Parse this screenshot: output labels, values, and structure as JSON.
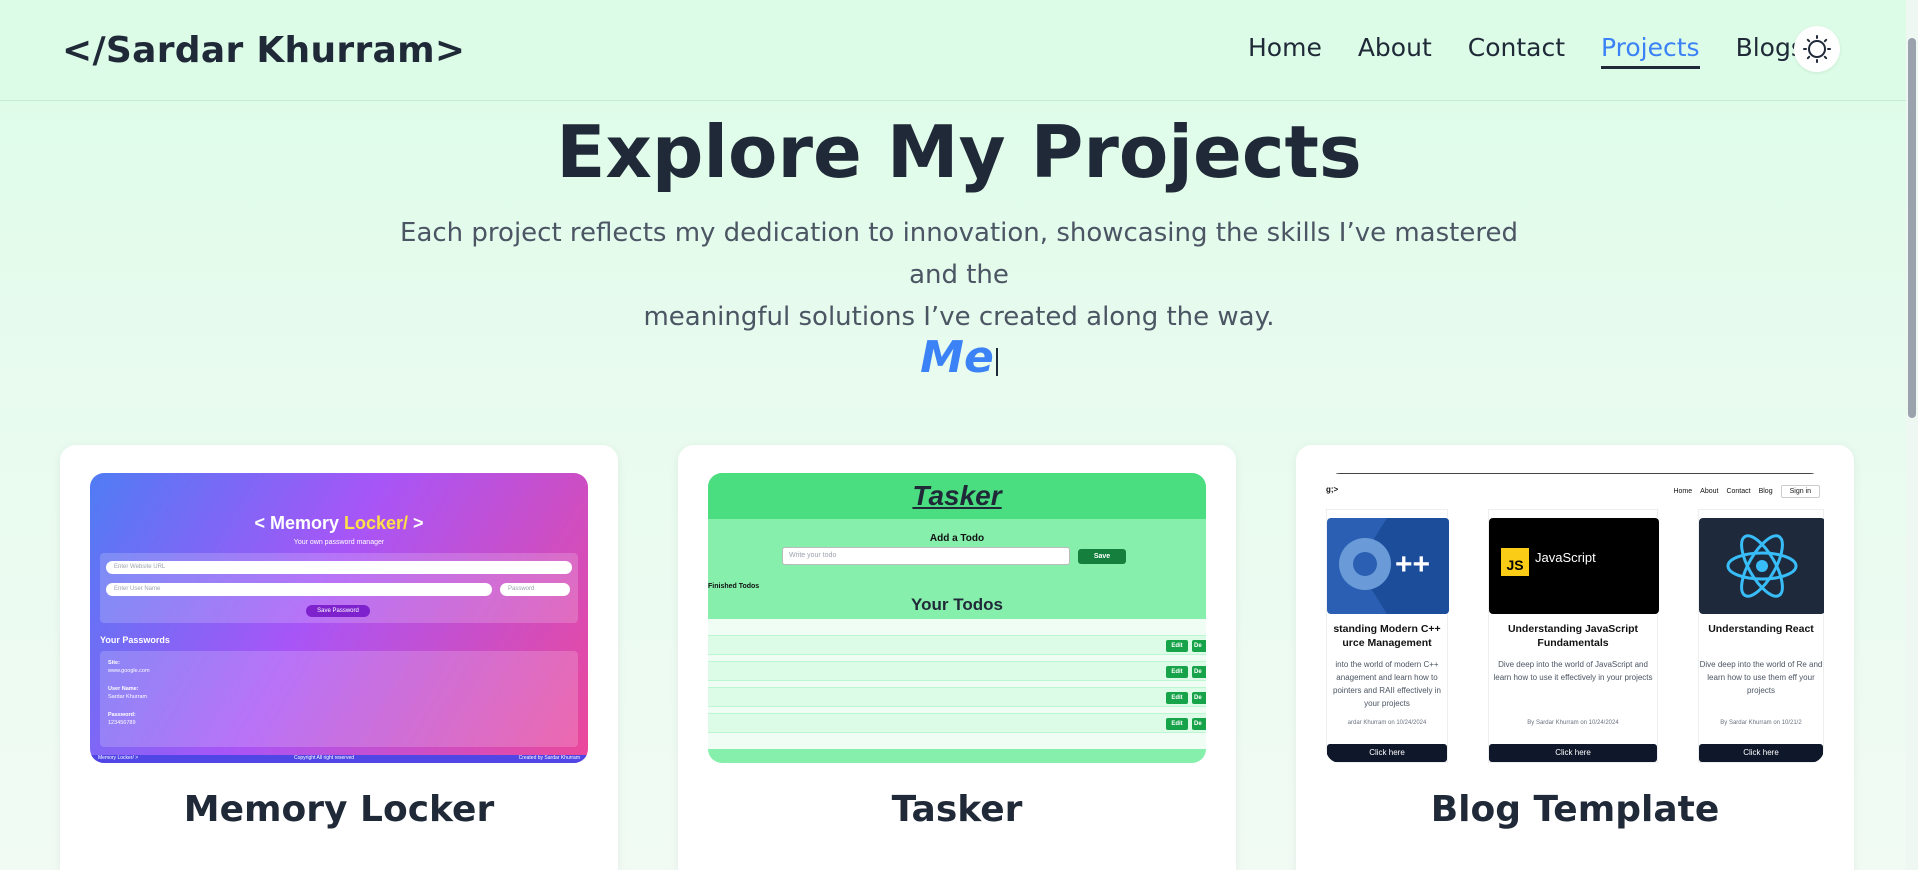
{
  "nav": {
    "logo": "</Sardar Khurram>",
    "links": [
      "Home",
      "About",
      "Contact",
      "Projects",
      "Blogs"
    ],
    "active": "Projects",
    "theme_icon": "sun-icon"
  },
  "hero": {
    "title": "Explore My Projects",
    "subtitle_line1": "Each project reflects my dedication to innovation, showcasing the skills I’ve mastered and the",
    "subtitle_line2": "meaningful solutions I’ve created along the way.",
    "typing_text": "Me"
  },
  "projects": [
    {
      "title": "Memory Locker",
      "preview": {
        "brand_left": "< Memory ",
        "brand_accent": "Locker/",
        "brand_right": " >",
        "tagline": "Your own password manager",
        "url_placeholder": "Enter Website URL",
        "user_placeholder": "Enter User Name",
        "pass_placeholder": "Password",
        "save_label": "Save Password",
        "list_heading": "Your Passwords",
        "site_label": "Site:",
        "site_value": "www.google.com",
        "user_label": "User Name:",
        "user_value": "Sardar Khurram",
        "pass_label": "Password:",
        "pass_value": "123456789",
        "footer_left": "Memory Locker/ >",
        "footer_mid": "Copyright All right reserved",
        "footer_right": "Created by Sardar Khurram"
      }
    },
    {
      "title": "Tasker",
      "preview": {
        "brand": "Tasker",
        "add_heading": "Add a Todo",
        "input_placeholder": "Write your todo",
        "save_label": "Save",
        "finished_label": "Finished Todos",
        "list_heading": "Your Todos",
        "edit_label": "Edit",
        "delete_label": "De"
      }
    },
    {
      "title": "Blog Template",
      "preview": {
        "logo": "g;>",
        "nav": [
          "Home",
          "About",
          "Contact",
          "Blog"
        ],
        "sign_in": "Sign in",
        "posts": [
          {
            "title_line1": "standing Modern C++",
            "title_line2": "urce Management",
            "desc": "into the world of modern C++ anagement and learn how to pointers and RAII effectively in your projects",
            "meta": "ardar Khurram on 10/24/2024",
            "button": "Click here",
            "thumb_icon": "cpp-logo-icon"
          },
          {
            "title_line1": "Understanding JavaScript",
            "title_line2": "Fundamentals",
            "desc": "Dive deep into the world of JavaScript and learn how to use it effectively in your projects",
            "meta": "By Sardar Khurram on 10/24/2024",
            "button": "Click here",
            "thumb_text": "JavaScript",
            "thumb_badge": "JS"
          },
          {
            "title_line1": "Understanding React",
            "title_line2": "",
            "desc": "Dive deep into the world of Re and learn how to use them eff your projects",
            "meta": "By Sardar Khurram on 10/21/2",
            "button": "Click here",
            "thumb_icon": "react-logo-icon"
          }
        ]
      }
    }
  ]
}
